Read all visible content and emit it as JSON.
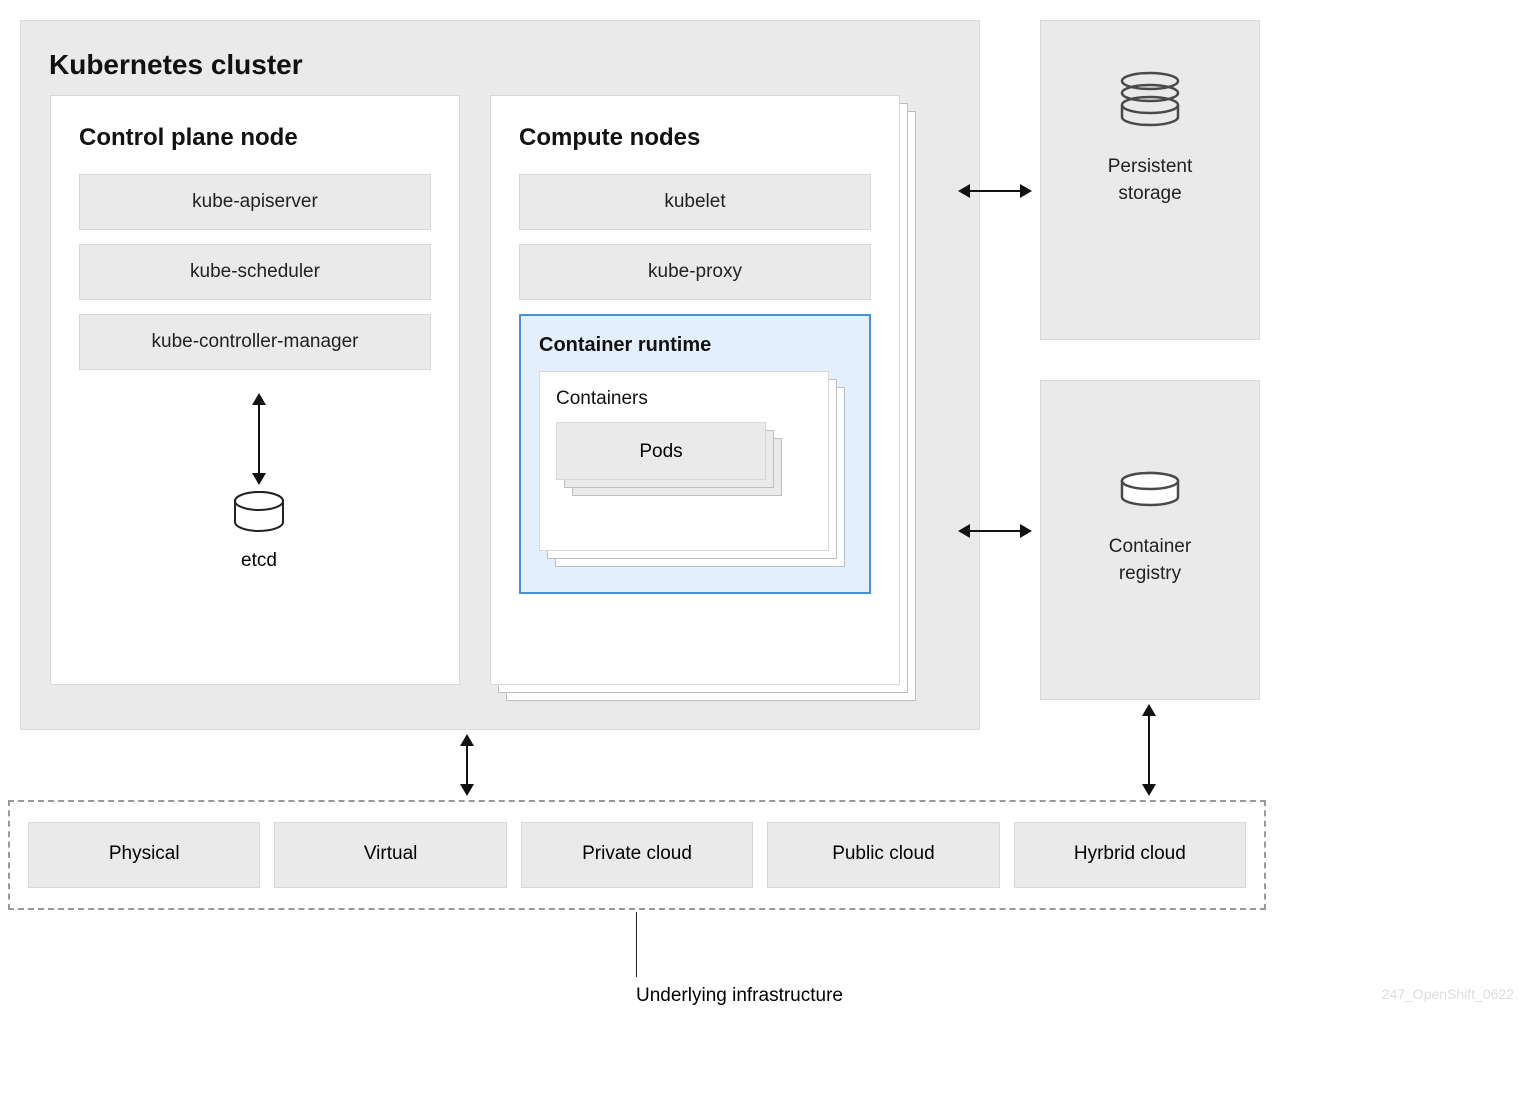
{
  "cluster": {
    "title": "Kubernetes cluster",
    "control_plane": {
      "title": "Control plane node",
      "components": [
        "kube-apiserver",
        "kube-scheduler",
        "kube-controller-manager"
      ],
      "datastore": "etcd"
    },
    "compute": {
      "title": "Compute nodes",
      "components": [
        "kubelet",
        "kube-proxy"
      ],
      "runtime": {
        "title": "Container runtime",
        "containers_label": "Containers",
        "pods_label": "Pods"
      }
    }
  },
  "side": {
    "storage": "Persistent storage",
    "registry": "Container registry"
  },
  "infrastructure": {
    "label": "Underlying infrastructure",
    "types": [
      "Physical",
      "Virtual",
      "Private cloud",
      "Public cloud",
      "Hyrbrid cloud"
    ]
  },
  "watermark": "247_OpenShift_0622"
}
